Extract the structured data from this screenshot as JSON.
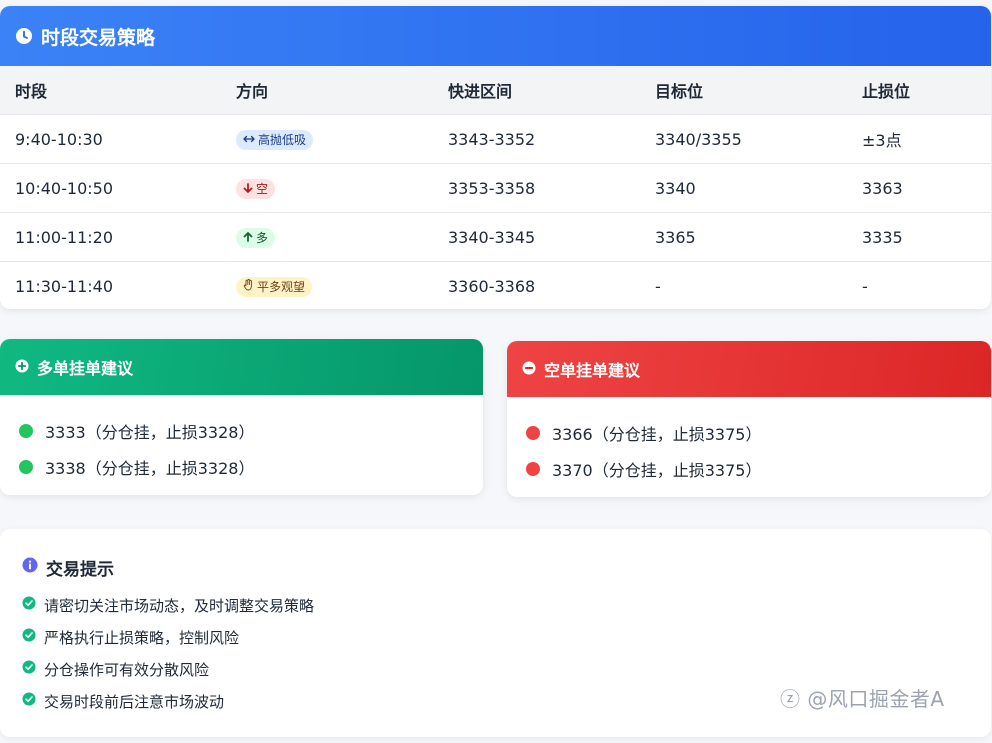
{
  "strategy": {
    "title": "时段交易策略",
    "columns": [
      "时段",
      "方向",
      "快进区间",
      "目标位",
      "止损位"
    ],
    "rows": [
      {
        "time": "9:40-10:30",
        "direction": "高抛低吸",
        "dir_type": "neutral",
        "range": "3343-3352",
        "target": "3340/3355",
        "stop": "±3点"
      },
      {
        "time": "10:40-10:50",
        "direction": "空",
        "dir_type": "short",
        "range": "3353-3358",
        "target": "3340",
        "stop": "3363"
      },
      {
        "time": "11:00-11:20",
        "direction": "多",
        "dir_type": "long",
        "range": "3340-3345",
        "target": "3365",
        "stop": "3335"
      },
      {
        "time": "11:30-11:40",
        "direction": "平多观望",
        "dir_type": "watch",
        "range": "3360-3368",
        "target": "-",
        "stop": "-"
      }
    ]
  },
  "long_orders": {
    "title": "多单挂单建议",
    "items": [
      "3333（分仓挂，止损3328）",
      "3338（分仓挂，止损3328）"
    ]
  },
  "short_orders": {
    "title": "空单挂单建议",
    "items": [
      "3366（分仓挂，止损3375）",
      "3370（分仓挂，止损3375）"
    ]
  },
  "tips": {
    "title": "交易提示",
    "items": [
      "请密切关注市场动态，及时调整交易策略",
      "严格执行止损策略，控制风险",
      "分仓操作可有效分散风险",
      "交易时段前后注意市场波动"
    ]
  },
  "watermark": "@风口掘金者A",
  "colors": {
    "header_blue": "#2563eb",
    "long_green": "#059669",
    "short_red": "#dc2626",
    "tip_check": "#10b981",
    "info_icon": "#6366f1"
  },
  "icons": {
    "header": "clock-icon",
    "neutral": "left-right-arrow-icon",
    "short": "arrow-down-icon",
    "long": "arrow-up-icon",
    "watch": "hand-icon",
    "long_header": "plus-circle-icon",
    "short_header": "minus-circle-icon",
    "tips_title": "info-circle-icon",
    "tip_item": "check-circle-icon",
    "watermark": "zhihu-logo-icon"
  }
}
